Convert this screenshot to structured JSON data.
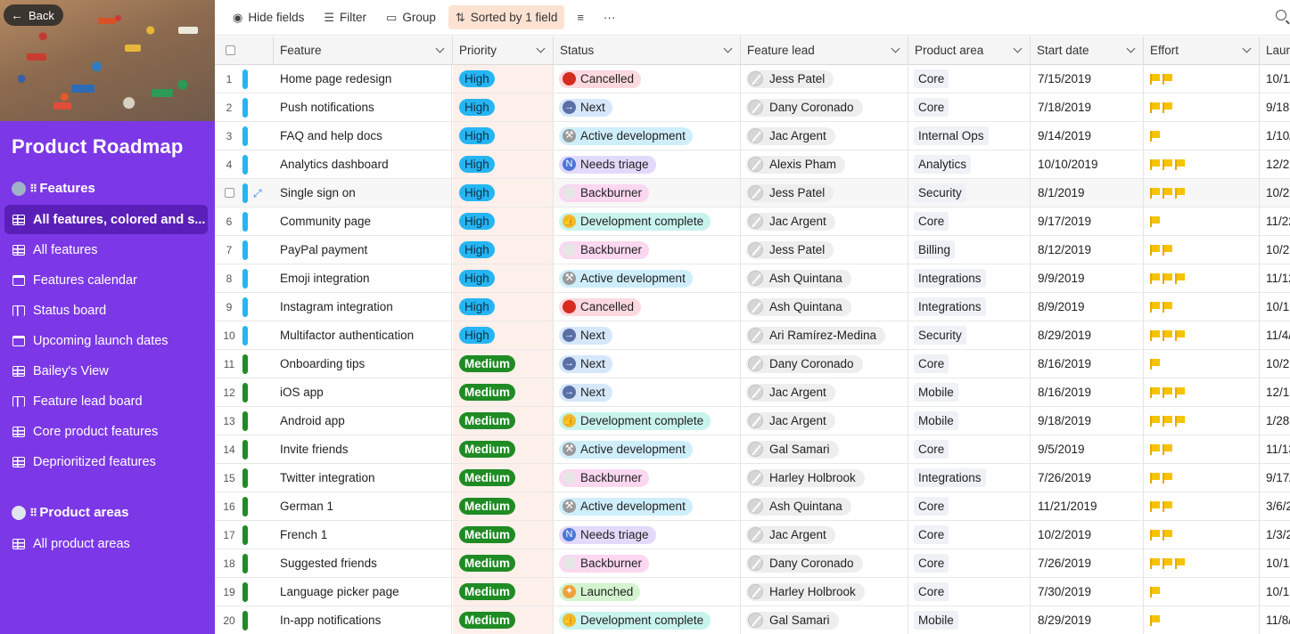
{
  "sidebar": {
    "back_label": "Back",
    "title": "Product Roadmap",
    "sections": [
      {
        "label": "Features",
        "items": [
          {
            "label": "All features, colored and s...",
            "icon": "grid-view-icon",
            "active": true
          },
          {
            "label": "All features",
            "icon": "grid-view-icon"
          },
          {
            "label": "Features calendar",
            "icon": "calendar-view-icon"
          },
          {
            "label": "Status board",
            "icon": "kanban-view-icon"
          },
          {
            "label": "Upcoming launch dates",
            "icon": "calendar-view-icon"
          },
          {
            "label": "Bailey's View",
            "icon": "grid-view-icon"
          },
          {
            "label": "Feature lead board",
            "icon": "kanban-view-icon"
          },
          {
            "label": "Core product features",
            "icon": "grid-view-icon"
          },
          {
            "label": "Deprioritized features",
            "icon": "grid-view-icon"
          }
        ]
      },
      {
        "label": "Product areas",
        "items": [
          {
            "label": "All product areas",
            "icon": "grid-view-icon"
          }
        ]
      }
    ]
  },
  "toolbar": {
    "hide_fields": "Hide fields",
    "filter": "Filter",
    "group": "Group",
    "sorted": "Sorted by 1 field",
    "more": "···"
  },
  "columns": [
    "Feature",
    "Priority",
    "Status",
    "Feature lead",
    "Product area",
    "Start date",
    "Effort",
    "Laun"
  ],
  "status_styles": {
    "Cancelled": {
      "bg": "#fcd9de",
      "icon": "#d62b1f",
      "glyph": ""
    },
    "Next": {
      "bg": "#d6e7fb",
      "icon": "#5b6fa6",
      "glyph": "→"
    },
    "Active development": {
      "bg": "#cfeefc",
      "icon": "#9a9a9a",
      "glyph": "⚒"
    },
    "Needs triage": {
      "bg": "#e2dafb",
      "icon": "#4d76d9",
      "glyph": "N"
    },
    "Backburner": {
      "bg": "#fbd7f0",
      "icon": "#e6e6e6",
      "glyph": ""
    },
    "Development complete": {
      "bg": "#c9f3ee",
      "icon": "#f2b92b",
      "glyph": "👍"
    },
    "Launched": {
      "bg": "#d4f3cf",
      "icon": "#f0a13a",
      "glyph": "✦"
    }
  },
  "priority_colors": {
    "High": "#26b5f2",
    "Medium": "#1f8b24"
  },
  "rows": [
    {
      "num": "1",
      "feature": "Home page redesign",
      "priority": "High",
      "status": "Cancelled",
      "lead": "Jess Patel",
      "area": "Core",
      "start": "7/15/2019",
      "effort": 2,
      "launch": "10/1/"
    },
    {
      "num": "2",
      "feature": "Push notifications",
      "priority": "High",
      "status": "Next",
      "lead": "Dany Coronado",
      "area": "Core",
      "start": "7/18/2019",
      "effort": 2,
      "launch": "9/18"
    },
    {
      "num": "3",
      "feature": "FAQ and help docs",
      "priority": "High",
      "status": "Active development",
      "lead": "Jac Argent",
      "area": "Internal Ops",
      "start": "9/14/2019",
      "effort": 1,
      "launch": "1/10/"
    },
    {
      "num": "4",
      "feature": "Analytics dashboard",
      "priority": "High",
      "status": "Needs triage",
      "lead": "Alexis Pham",
      "area": "Analytics",
      "start": "10/10/2019",
      "effort": 3,
      "launch": "12/2"
    },
    {
      "num": "",
      "feature": "Single sign on",
      "priority": "High",
      "status": "Backburner",
      "lead": "Jess Patel",
      "area": "Security",
      "start": "8/1/2019",
      "effort": 3,
      "launch": "10/2",
      "hover": true
    },
    {
      "num": "6",
      "feature": "Community page",
      "priority": "High",
      "status": "Development complete",
      "lead": "Jac Argent",
      "area": "Core",
      "start": "9/17/2019",
      "effort": 1,
      "launch": "11/22"
    },
    {
      "num": "7",
      "feature": "PayPal payment",
      "priority": "High",
      "status": "Backburner",
      "lead": "Jess Patel",
      "area": "Billing",
      "start": "8/12/2019",
      "effort": 2,
      "launch": "10/2"
    },
    {
      "num": "8",
      "feature": "Emoji integration",
      "priority": "High",
      "status": "Active development",
      "lead": "Ash Quintana",
      "area": "Integrations",
      "start": "9/9/2019",
      "effort": 3,
      "launch": "11/12"
    },
    {
      "num": "9",
      "feature": "Instagram integration",
      "priority": "High",
      "status": "Cancelled",
      "lead": "Ash Quintana",
      "area": "Integrations",
      "start": "8/9/2019",
      "effort": 2,
      "launch": "10/19"
    },
    {
      "num": "10",
      "feature": "Multifactor authentication",
      "priority": "High",
      "status": "Next",
      "lead": "Ari Ramírez-Medina",
      "area": "Security",
      "start": "8/29/2019",
      "effort": 3,
      "launch": "11/4/"
    },
    {
      "num": "11",
      "feature": "Onboarding tips",
      "priority": "Medium",
      "status": "Next",
      "lead": "Dany Coronado",
      "area": "Core",
      "start": "8/16/2019",
      "effort": 1,
      "launch": "10/2"
    },
    {
      "num": "12",
      "feature": "iOS app",
      "priority": "Medium",
      "status": "Next",
      "lead": "Jac Argent",
      "area": "Mobile",
      "start": "8/16/2019",
      "effort": 3,
      "launch": "12/13"
    },
    {
      "num": "13",
      "feature": "Android app",
      "priority": "Medium",
      "status": "Development complete",
      "lead": "Jac Argent",
      "area": "Mobile",
      "start": "9/18/2019",
      "effort": 3,
      "launch": "1/28"
    },
    {
      "num": "14",
      "feature": "Invite friends",
      "priority": "Medium",
      "status": "Active development",
      "lead": "Gal Samari",
      "area": "Core",
      "start": "9/5/2019",
      "effort": 2,
      "launch": "11/13"
    },
    {
      "num": "15",
      "feature": "Twitter integration",
      "priority": "Medium",
      "status": "Backburner",
      "lead": "Harley Holbrook",
      "area": "Integrations",
      "start": "7/26/2019",
      "effort": 2,
      "launch": "9/17/"
    },
    {
      "num": "16",
      "feature": "German 1",
      "priority": "Medium",
      "status": "Active development",
      "lead": "Ash Quintana",
      "area": "Core",
      "start": "11/21/2019",
      "effort": 2,
      "launch": "3/6/2"
    },
    {
      "num": "17",
      "feature": "French 1",
      "priority": "Medium",
      "status": "Needs triage",
      "lead": "Jac Argent",
      "area": "Core",
      "start": "10/2/2019",
      "effort": 2,
      "launch": "1/3/2"
    },
    {
      "num": "18",
      "feature": "Suggested friends",
      "priority": "Medium",
      "status": "Backburner",
      "lead": "Dany Coronado",
      "area": "Core",
      "start": "7/26/2019",
      "effort": 3,
      "launch": "10/12"
    },
    {
      "num": "19",
      "feature": "Language picker page",
      "priority": "Medium",
      "status": "Launched",
      "lead": "Harley Holbrook",
      "area": "Core",
      "start": "7/30/2019",
      "effort": 1,
      "launch": "10/1"
    },
    {
      "num": "20",
      "feature": "In-app notifications",
      "priority": "Medium",
      "status": "Development complete",
      "lead": "Gal Samari",
      "area": "Mobile",
      "start": "8/29/2019",
      "effort": 1,
      "launch": "11/8/"
    }
  ]
}
